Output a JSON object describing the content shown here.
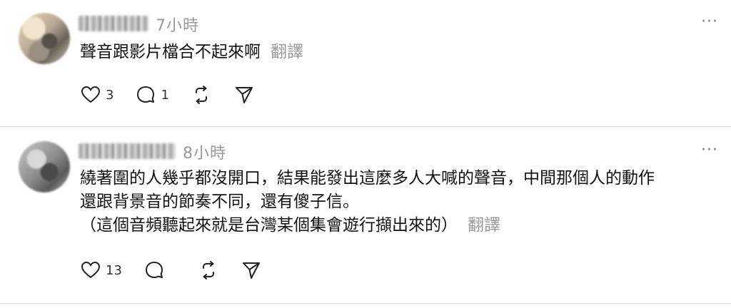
{
  "posts": [
    {
      "time": "7小時",
      "text_lines": [
        "聲音跟影片檔合不起來啊"
      ],
      "translate_label": "翻譯",
      "like_count": "3",
      "reply_count": "1"
    },
    {
      "time": "8小時",
      "text_lines": [
        "繞著圍的人幾乎都沒開口，結果能發出這麼多人大喊的聲音，中間那個人的動作",
        "還跟背景音的節奏不同，還有傻子信。",
        "（這個音頻聽起來就是台灣某個集會遊行擷出來的）"
      ],
      "translate_label": "翻譯",
      "like_count": "13",
      "reply_count": ""
    }
  ],
  "icons": {
    "like": "heart-icon",
    "reply": "comment-icon",
    "repost": "repost-icon",
    "share": "send-icon",
    "more": "more-icon"
  },
  "more_label": "···"
}
